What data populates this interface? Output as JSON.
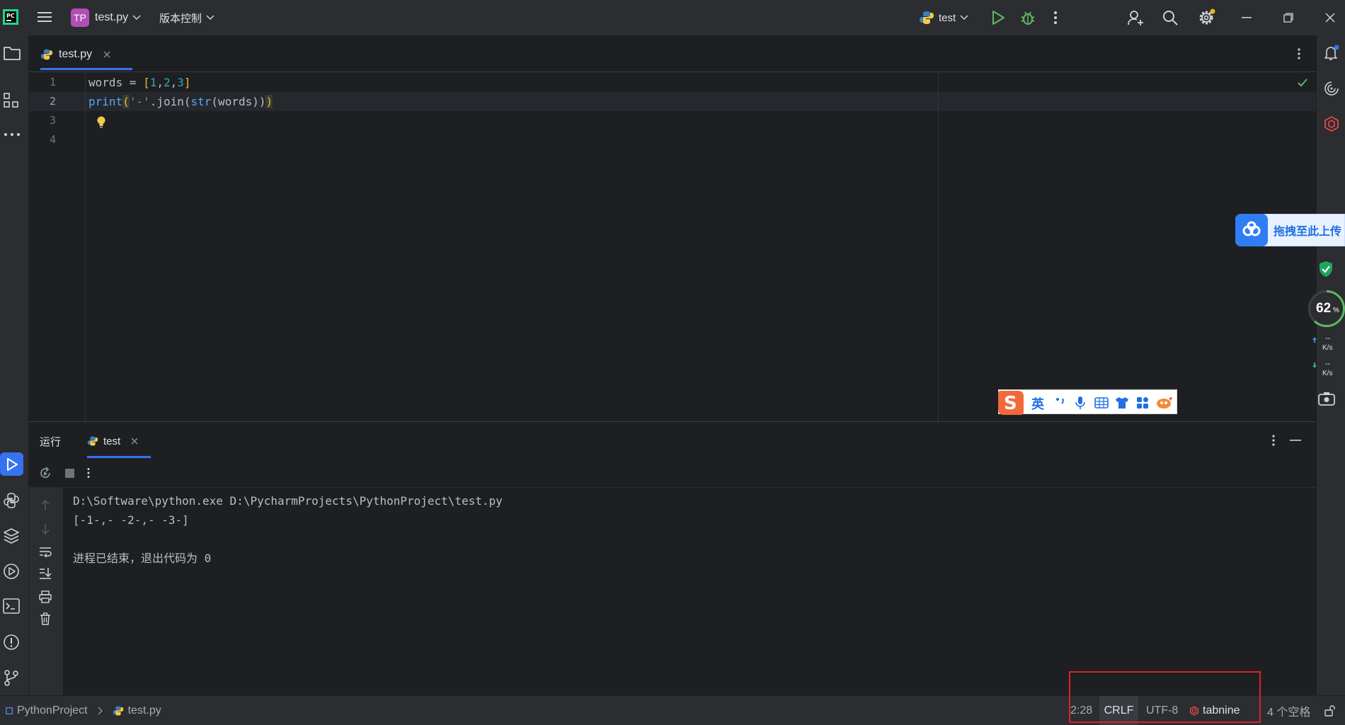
{
  "titlebar": {
    "project_badge": "TP",
    "project_name": "test.py",
    "vcs_label": "版本控制",
    "run_config": "test"
  },
  "editor": {
    "tab_label": "test.py",
    "line_numbers": [
      "1",
      "2",
      "3",
      "4"
    ],
    "lines": [
      {
        "l1": "words",
        "l2": " = ",
        "l3": "[",
        "l4": "1",
        "l5": ",",
        "l6": "2",
        "l7": ",",
        "l8": "3",
        "l9": "]"
      },
      {
        "p1": "print",
        "p2": "(",
        "p3": "'-'",
        "p4": ".join(",
        "p5": "str",
        "p6": "(words))",
        "p7": ")"
      }
    ]
  },
  "run_panel": {
    "title": "运行",
    "tab_label": "test",
    "console": [
      "D:\\Software\\python.exe D:\\PycharmProjects\\PythonProject\\test.py",
      "[-1-,- -2-,- -3-]",
      "",
      "进程已结束，退出代码为 0"
    ]
  },
  "statusbar": {
    "breadcrumb_project": "PythonProject",
    "breadcrumb_file": "test.py",
    "position": "2:28",
    "line_separator": "CRLF",
    "encoding": "UTF-8",
    "plugin": "tabnine",
    "indent": "4 个空格"
  },
  "overlays": {
    "baidu_upload": "拖拽至此上传",
    "ime_mode": "英",
    "cpu_percent": "62",
    "percent_sign": "%",
    "upload_speed_value": "--",
    "upload_speed_unit": "K/s",
    "download_speed_value": "--",
    "download_speed_unit": "K/s"
  },
  "colors": {
    "accent": "#3574f0",
    "run_green": "#5fb865",
    "highlight_red": "#e0202a"
  }
}
